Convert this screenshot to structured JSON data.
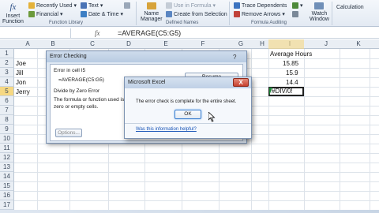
{
  "ribbon": {
    "insert_function": "Insert\nFunction",
    "recently_used": "Recently Used",
    "financial": "Financial",
    "text": "Text",
    "date_time": "Date & Time",
    "function_library": "Function Library",
    "name_manager": "Name\nManager",
    "create_from_selection": "Create from Selection",
    "use_in_formula": "Use in Formula",
    "defined_names": "Defined Names",
    "trace_dependents": "Trace Dependents",
    "remove_arrows": "Remove Arrows",
    "formula_auditing": "Formula Auditing",
    "watch_window": "Watch\nWindow",
    "calculation": "Calculation"
  },
  "formula_bar": {
    "fx": "fx",
    "formula": "=AVERAGE(C5:G5)"
  },
  "columns": [
    "A",
    "B",
    "C",
    "D",
    "E",
    "F",
    "G",
    "H",
    "I",
    "J",
    "K"
  ],
  "rows": [
    "1",
    "2",
    "3",
    "4",
    "5",
    "6",
    "7",
    "8",
    "9",
    "10",
    "11",
    "12",
    "13",
    "14",
    "15",
    "16",
    "17"
  ],
  "cells": {
    "a2": "Joe",
    "a3": "Jill",
    "a4": "Jon",
    "a5": "Jerry",
    "i1": "Average Hours",
    "i2": "15.85",
    "i3": "15.9",
    "i4": "14.4",
    "i5": "#DIV/0!"
  },
  "error_dialog": {
    "title": "Error Checking",
    "error_in": "Error in cell I5",
    "formula": "=AVERAGE(C5:G5)",
    "error_type": "Divide by Zero Error",
    "desc_line1": "The formula or function used is",
    "desc_line2": "zero or empty cells.",
    "resume": "Resume",
    "options": "Options..."
  },
  "message_dialog": {
    "title": "Microsoft Excel",
    "close": "X",
    "message": "The error check is complete for the entire sheet.",
    "ok": "OK",
    "help_link": "Was this information helpful?"
  }
}
